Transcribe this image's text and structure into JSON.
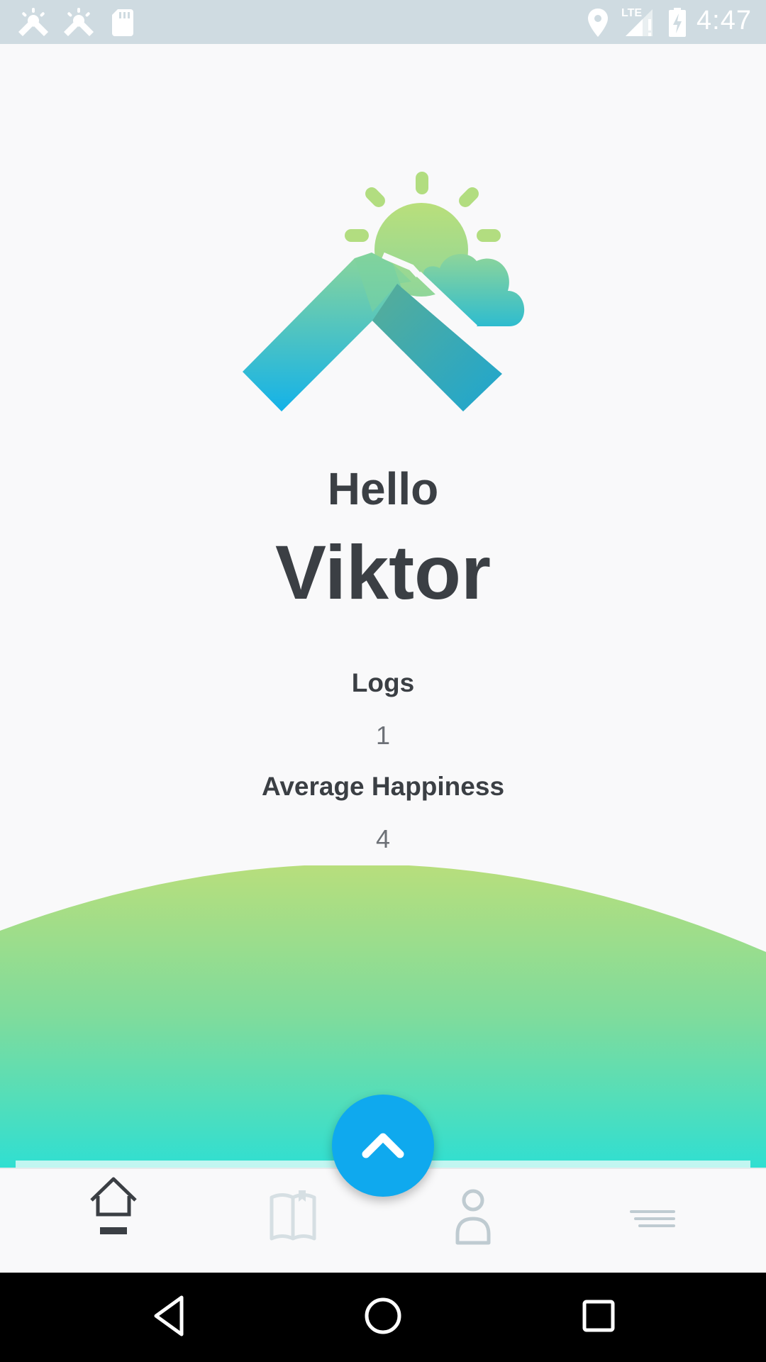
{
  "status_bar": {
    "time": "4:47",
    "network_label": "LTE",
    "icons": [
      "app-notification-icon",
      "app-notification-icon",
      "sd-card-icon",
      "location-icon",
      "signal-icon",
      "battery-charging-icon"
    ]
  },
  "home": {
    "greeting": "Hello",
    "username": "Viktor",
    "stats": [
      {
        "label": "Logs",
        "value": "1"
      },
      {
        "label": "Average Happiness",
        "value": "4"
      }
    ]
  },
  "fab": {
    "icon": "chevron-up-icon"
  },
  "bottom_nav": {
    "items": [
      {
        "icon": "home-icon",
        "active": true
      },
      {
        "icon": "journal-icon",
        "active": false
      },
      {
        "icon": "profile-icon",
        "active": false
      },
      {
        "icon": "menu-icon",
        "active": false
      }
    ]
  },
  "system_nav": {
    "icons": [
      "back-icon",
      "home-circle-icon",
      "recents-icon"
    ]
  },
  "colors": {
    "text_primary": "#3b3f44",
    "text_secondary": "#6d7177",
    "accent": "#0fa9ee",
    "gradient_green": "#b8de7c",
    "gradient_teal": "#2fdfd2",
    "status_bar": "#cfdbe1"
  }
}
